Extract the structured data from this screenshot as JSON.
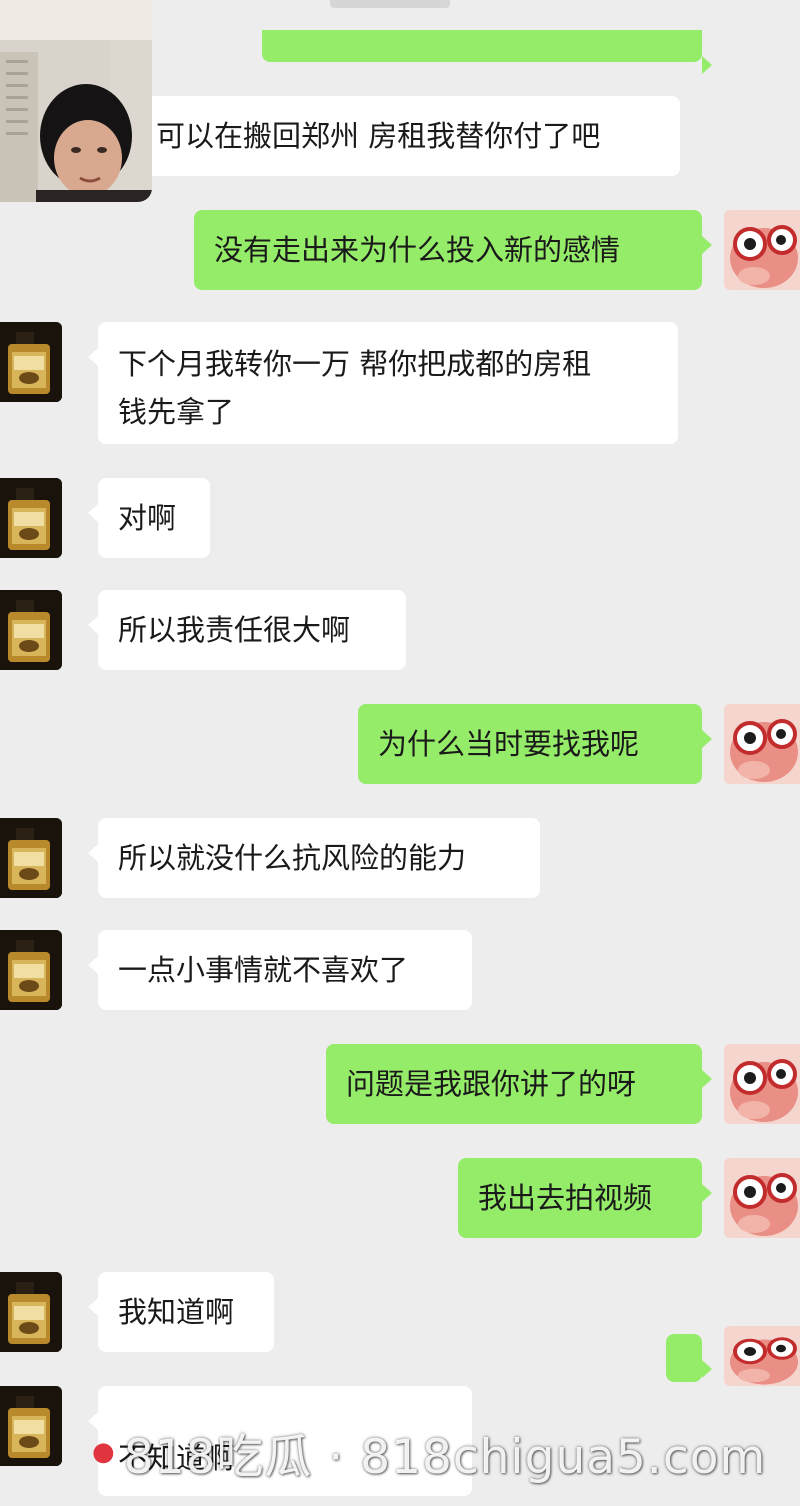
{
  "messages": [
    {
      "side": "in",
      "text": "可以在搬回郑州 房租我替你付了吧"
    },
    {
      "side": "out",
      "text": "没有走出来为什么投入新的感情"
    },
    {
      "side": "in",
      "text": "下个月我转你一万 帮你把成都的房租\n钱先拿了"
    },
    {
      "side": "in",
      "text": "对啊"
    },
    {
      "side": "in",
      "text": "所以我责任很大啊"
    },
    {
      "side": "out",
      "text": "为什么当时要找我呢"
    },
    {
      "side": "in",
      "text": "所以就没什么抗风险的能力"
    },
    {
      "side": "in",
      "text": "一点小事情就不喜欢了"
    },
    {
      "side": "out",
      "text": "问题是我跟你讲了的呀"
    },
    {
      "side": "out",
      "text": "我出去拍视频"
    },
    {
      "side": "in",
      "text": "我知道啊"
    },
    {
      "side": "out",
      "text": ""
    },
    {
      "side": "in",
      "text": "不知道啊"
    }
  ],
  "watermark": {
    "text": "818吃瓜 · 818chigua5.com"
  },
  "colors": {
    "background": "#ededed",
    "incoming_bubble": "#ffffff",
    "outgoing_bubble": "#95ec69"
  },
  "icons": {
    "left_avatar": "perfume-bottle-avatar",
    "right_avatar": "pink-cartoon-glasses-avatar",
    "video_call": "video-call-thumbnail"
  }
}
